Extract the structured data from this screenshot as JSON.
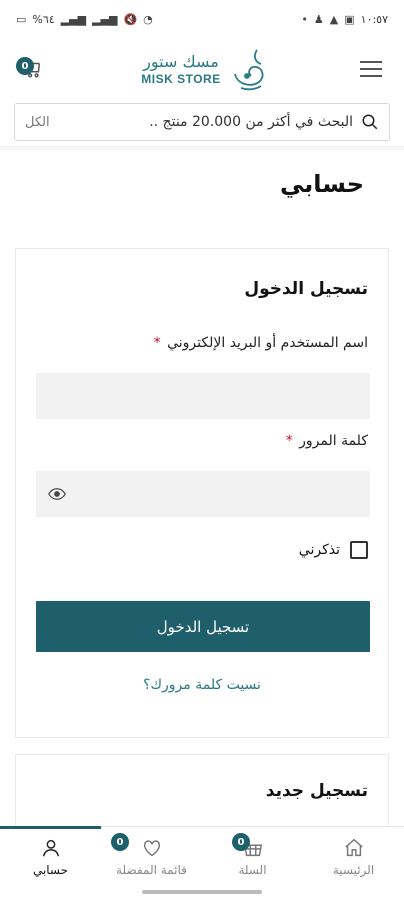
{
  "status_bar": {
    "time": "١٠:٥٧",
    "battery": "%٦٤"
  },
  "header": {
    "cart_count": "0",
    "logo_ar": "مسك ستور",
    "logo_en": "MISK STORE"
  },
  "search": {
    "placeholder": "البحث في أكثر من 20.000 منتج ..",
    "scope": "الكل"
  },
  "page_title": "حسابي",
  "login": {
    "title": "تسجيل الدخول",
    "username_label": "اسم المستخدم أو البريد الإلكتروني",
    "password_label": "كلمة المرور",
    "required_mark": "*",
    "remember_label": "تذكرني",
    "submit_label": "تسجيل الدخول",
    "forgot_label": "نسيت كلمة مرورك؟"
  },
  "register": {
    "title": "تسجيل جديد"
  },
  "bottom_nav": {
    "items": [
      {
        "label": "حسابي",
        "icon": "user-icon",
        "active": true
      },
      {
        "label": "قائمة المفضلة",
        "icon": "heart-icon",
        "badge": "0"
      },
      {
        "label": "السلة",
        "icon": "basket-icon",
        "badge": "0"
      },
      {
        "label": "الرئيسية",
        "icon": "home-icon"
      }
    ]
  },
  "colors": {
    "primary": "#1f5f6b",
    "accent": "#2a7a85",
    "required": "#c8102e"
  }
}
